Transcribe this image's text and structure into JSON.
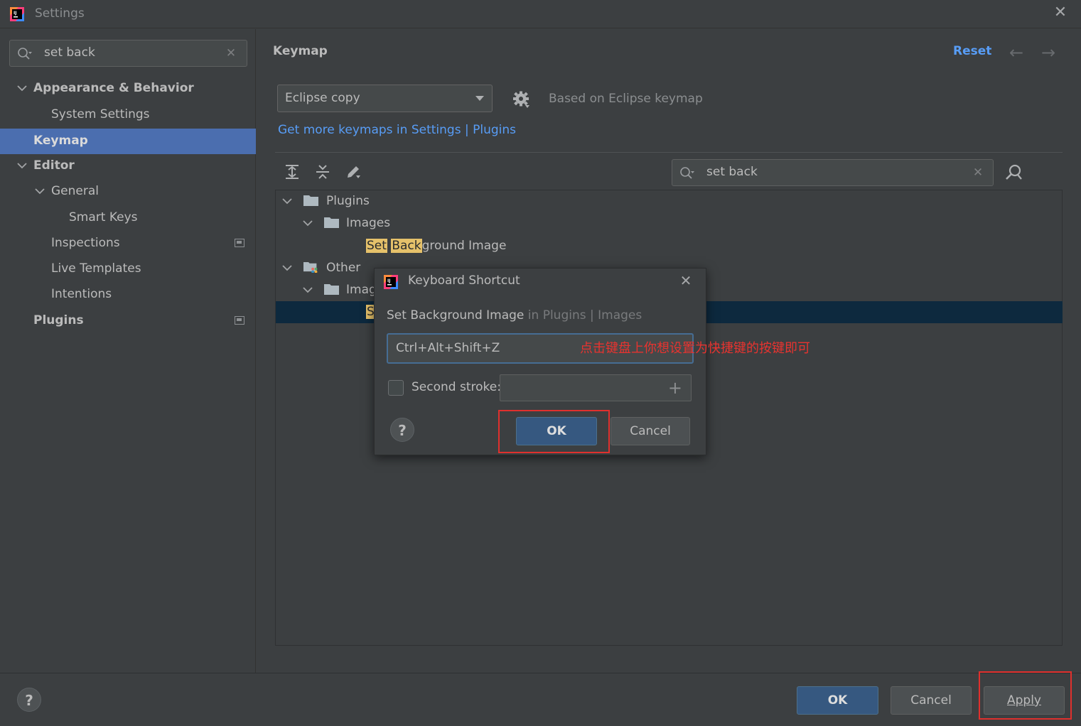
{
  "window": {
    "title": "Settings"
  },
  "sidebar": {
    "search_value": "set back",
    "items": [
      {
        "label": "Appearance & Behavior"
      },
      {
        "label": "System Settings"
      },
      {
        "label": "Keymap"
      },
      {
        "label": "Editor"
      },
      {
        "label": "General"
      },
      {
        "label": "Smart Keys"
      },
      {
        "label": "Inspections"
      },
      {
        "label": "Live Templates"
      },
      {
        "label": "Intentions"
      },
      {
        "label": "Plugins"
      }
    ]
  },
  "main": {
    "title": "Keymap",
    "reset_label": "Reset",
    "keymap_select": "Eclipse copy",
    "based_on": "Based on Eclipse keymap",
    "get_more_link": "Get more keymaps in Settings | Plugins",
    "search_value": "set back",
    "tree": {
      "plugins": "Plugins",
      "images_1": "Images",
      "match_1": "Set",
      "match_2": "Back",
      "match_rest": "ground Image",
      "other": "Other",
      "images_2_partial": "Imag",
      "selected_partial": "S"
    }
  },
  "dialog": {
    "title": "Keyboard Shortcut",
    "action_name": "Set Background Image",
    "action_path": " in Plugins | Images",
    "shortcut_value": "Ctrl+Alt+Shift+Z",
    "annotation": "点击键盘上你想设置为快捷键的按键即可",
    "second_stroke_label": "Second stroke:",
    "ok_label": "OK",
    "cancel_label": "Cancel",
    "help_label": "?"
  },
  "footer": {
    "help_label": "?",
    "ok_label": "OK",
    "cancel_label": "Cancel",
    "apply_label": "Apply"
  },
  "colors": {
    "accent": "#4b6eaf",
    "link": "#589df6",
    "highlight": "#e5c16a",
    "annotation": "#e8332f"
  }
}
